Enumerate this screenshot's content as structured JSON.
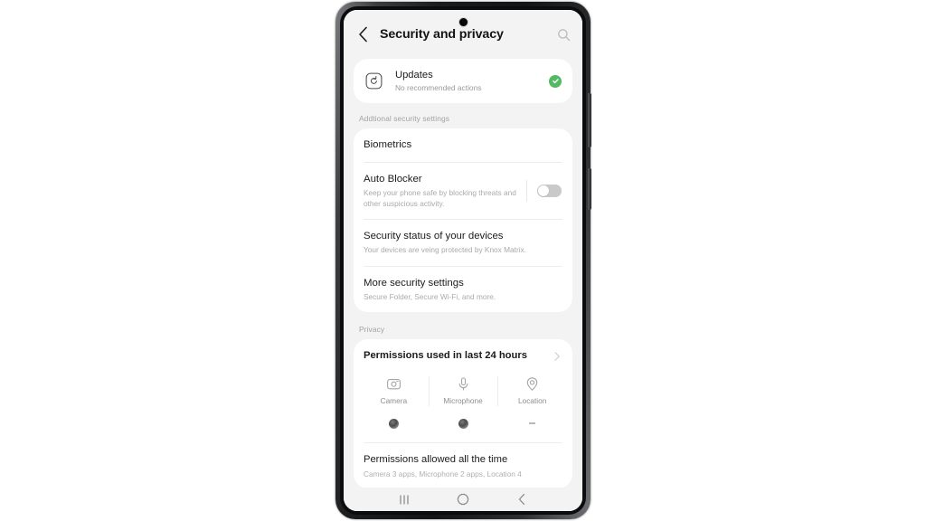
{
  "device": {
    "frame": "samsung-galaxy-phone",
    "punch_hole_camera": true,
    "side_buttons": [
      "volume-rocker",
      "power-button"
    ],
    "background_color": "#ffffff"
  },
  "appbar": {
    "back_icon": "chevron-left-icon",
    "title": "Security and privacy",
    "search_icon": "search-icon"
  },
  "updates": {
    "icon": "update-refresh-icon",
    "title": "Updates",
    "subtitle": "No recommended actions",
    "status_icon": "green-check-circle-icon",
    "status_color": "#53b963"
  },
  "security_section": {
    "label": "Addtional security settings",
    "rows": [
      {
        "title": "Biometrics",
        "subtitle": "",
        "has_toggle": false
      },
      {
        "title": "Auto Blocker",
        "subtitle": "Keep your phone safe by blocking threats and other suspicious activity.",
        "has_toggle": true,
        "toggle_state": "off"
      },
      {
        "title": "Security status of your devices",
        "subtitle": "Your devices are veing protected by Knox Matrix.",
        "has_toggle": false
      },
      {
        "title": "More security settings",
        "subtitle": "Secure Folder, Secure Wi-Fi, and more.",
        "has_toggle": false
      }
    ]
  },
  "privacy_section": {
    "label": "Privacy",
    "permissions_used": {
      "title": "Permissions used in last 24 hours",
      "chevron_icon": "chevron-right-icon",
      "columns": [
        {
          "icon": "camera-icon",
          "name": "Camera",
          "indicator": "dot"
        },
        {
          "icon": "microphone-icon",
          "name": "Microphone",
          "indicator": "dot"
        },
        {
          "icon": "location-pin-icon",
          "name": "Location",
          "indicator": "dash"
        }
      ]
    },
    "permissions_allowed": {
      "title": "Permissions allowed all the time",
      "subtitle": "Camera 3 apps, Microphone 2 apps, Location 4"
    }
  },
  "navbar": {
    "recents_icon": "recents-icon",
    "home_icon": "home-circle-icon",
    "back_icon": "back-chevron-icon"
  }
}
